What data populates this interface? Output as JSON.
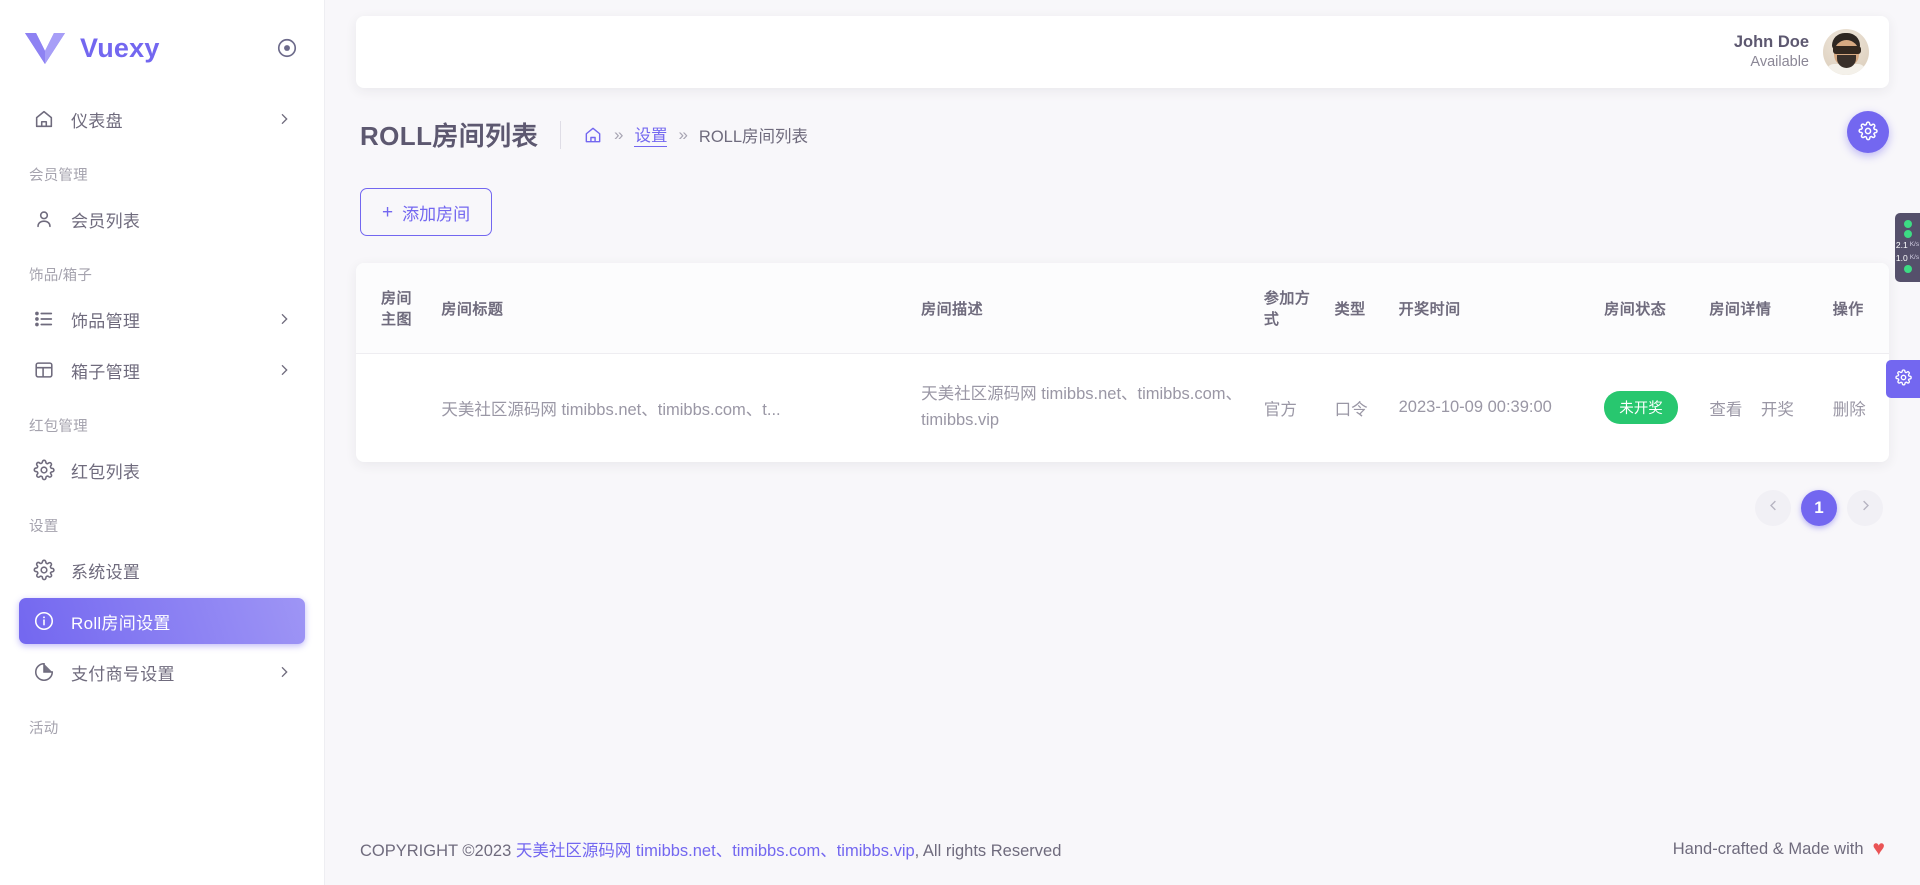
{
  "brand": {
    "name": "Vuexy",
    "logo_icon": "vuexy-logo-icon",
    "pin_icon": "circle-dot-pin-icon"
  },
  "sidebar": {
    "groups": [
      {
        "label": null,
        "items": [
          {
            "label": "仪表盘",
            "icon": "home-icon",
            "arrow": true,
            "active": false
          }
        ]
      },
      {
        "label": "会员管理",
        "items": [
          {
            "label": "会员列表",
            "icon": "user-icon",
            "arrow": false,
            "active": false
          }
        ]
      },
      {
        "label": "饰品/箱子",
        "items": [
          {
            "label": "饰品管理",
            "icon": "list-icon",
            "arrow": true,
            "active": false
          },
          {
            "label": "箱子管理",
            "icon": "layout-icon",
            "arrow": true,
            "active": false
          }
        ]
      },
      {
        "label": "红包管理",
        "items": [
          {
            "label": "红包列表",
            "icon": "gear-icon",
            "arrow": false,
            "active": false
          }
        ]
      },
      {
        "label": "设置",
        "items": [
          {
            "label": "系统设置",
            "icon": "gear-icon",
            "arrow": false,
            "active": false
          },
          {
            "label": "Roll房间设置",
            "icon": "info-icon",
            "arrow": false,
            "active": true
          },
          {
            "label": "支付商号设置",
            "icon": "pie-chart-icon",
            "arrow": true,
            "active": false
          }
        ]
      },
      {
        "label": "活动",
        "items": []
      }
    ]
  },
  "navbar": {
    "user": {
      "name": "John Doe",
      "status": "Available",
      "avatar_icon": "user-avatar"
    }
  },
  "page": {
    "title": "ROLL房间列表",
    "settings_fab_icon": "gear-icon",
    "breadcrumb": {
      "home_icon": "home-icon",
      "separator": "»",
      "link": "设置",
      "current": "ROLL房间列表"
    },
    "add_button": {
      "plus": "+",
      "label": "添加房间"
    }
  },
  "table": {
    "headers": {
      "image": "房间主图",
      "title": "房间标题",
      "desc": "房间描述",
      "join": "参加方式",
      "type": "类型",
      "time": "开奖时间",
      "state": "房间状态",
      "detail": "房间详情",
      "action": "操作"
    },
    "rows": [
      {
        "image": "",
        "title": "天美社区源码网 timibbs.net、timibbs.com、t...",
        "desc": "天美社区源码网 timibbs.net、timibbs.com、timibbs.vip",
        "join": "官方",
        "type": "口令",
        "time": "2023-10-09 00:39:00",
        "state": "未开奖",
        "state_color": "#28c76f",
        "detail": [
          "查看",
          "开奖"
        ],
        "action": "删除"
      }
    ]
  },
  "pagination": {
    "prev_icon": "chevron-left-icon",
    "next_icon": "chevron-right-icon",
    "pages": [
      "1"
    ],
    "current": "1"
  },
  "footer": {
    "prefix": "COPYRIGHT ©2023 ",
    "link1": "天美社区源码网 timibbs.net、timibbs.com、timibbs.vip",
    "suffix": ", All rights Reserved",
    "right_text": "Hand-crafted & Made with",
    "heart_icon": "heart-icon"
  },
  "widgets": {
    "network": {
      "down": "2.1",
      "down_unit": "K/s",
      "up": "1.0",
      "up_unit": "K/s"
    },
    "theme_fab_icon": "gear-icon"
  },
  "colors": {
    "accent": "#7367f0",
    "success": "#28c76f",
    "danger": "#ea5455"
  }
}
